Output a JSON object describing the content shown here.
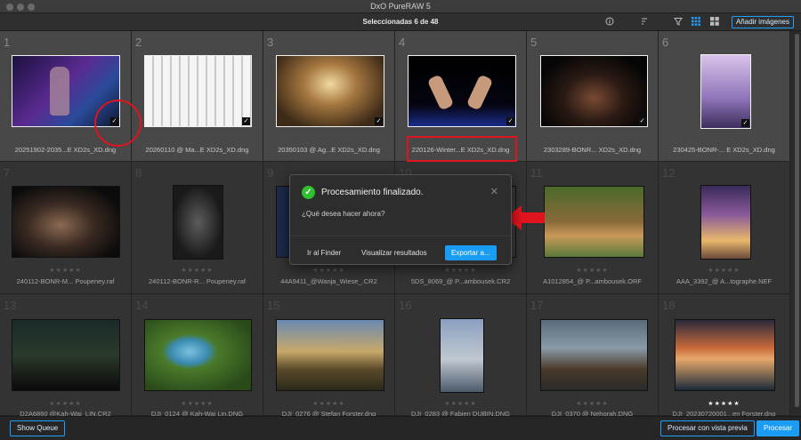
{
  "window": {
    "title": "DxO PureRAW 5"
  },
  "toolbar": {
    "selection_text": "Seleccionadas 6 de 48",
    "add_images_label": "Añadir imágenes",
    "icons": [
      "info-icon",
      "sort-icon",
      "filter-icon",
      "grid-view-icon",
      "compare-view-icon"
    ]
  },
  "colors": {
    "accent": "#1ea0ff",
    "annotation": "#e0141e",
    "success": "#2fbf2f"
  },
  "images": [
    {
      "num": "1",
      "name": "20251902-2035...E XD2s_XD.dng",
      "selected": true,
      "stars": null,
      "rating": 0
    },
    {
      "num": "2",
      "name": "20260110 @ Ma...E XD2s_XD.dng",
      "selected": true,
      "stars": null,
      "rating": 0
    },
    {
      "num": "3",
      "name": "20350103 @ Ag...E XD2s_XD.dng",
      "selected": true,
      "stars": null,
      "rating": 0
    },
    {
      "num": "4",
      "name": "220126-Winter...E XD2s_XD.dng",
      "selected": true,
      "stars": null,
      "rating": 0
    },
    {
      "num": "5",
      "name": "2303289-BONR... XD2s_XD.dng",
      "selected": true,
      "stars": null,
      "rating": 0
    },
    {
      "num": "6",
      "name": "230425-BONR-... E XD2s_XD.dng",
      "selected": true,
      "stars": null,
      "rating": 0
    },
    {
      "num": "7",
      "name": "240112-BONR-M... Poupeney.raf",
      "selected": false,
      "stars": "★★★★★",
      "rating": 0
    },
    {
      "num": "8",
      "name": "240112-BONR-R... Poupeney.raf",
      "selected": false,
      "stars": "★★★★★",
      "rating": 0
    },
    {
      "num": "9",
      "name": "44A9411_@Wanja_Wiese_.CR2",
      "selected": false,
      "stars": "★★★★★",
      "rating": 0
    },
    {
      "num": "10",
      "name": "5DS_8069_@ P...ambousek.CR2",
      "selected": false,
      "stars": "★★★★★",
      "rating": 0
    },
    {
      "num": "11",
      "name": "A1012854_@ P...ambousek.ORF",
      "selected": false,
      "stars": "★★★★★",
      "rating": 0
    },
    {
      "num": "12",
      "name": "AAA_3392_@ A...tographe.NEF",
      "selected": false,
      "stars": "★★★★★",
      "rating": 0
    },
    {
      "num": "13",
      "name": "D2A6860 @Kah-Wai_LIN.CR2",
      "selected": false,
      "stars": "★★★★★",
      "rating": 0
    },
    {
      "num": "14",
      "name": "DJI_0124 @ Kah-Wai Lin.DNG",
      "selected": false,
      "stars": "★★★★★",
      "rating": 0
    },
    {
      "num": "15",
      "name": "DJI_0276 @ Stefan Forster.dng",
      "selected": false,
      "stars": "★★★★★",
      "rating": 0
    },
    {
      "num": "16",
      "name": "DJI_0283 @ Fabien DUBIN.DNG",
      "selected": false,
      "stars": "★★★★★",
      "rating": 0
    },
    {
      "num": "17",
      "name": "DJI_0370 @ Nehorah.DNG",
      "selected": false,
      "stars": "★★★★★",
      "rating": 0
    },
    {
      "num": "18",
      "name": "DJI_20230720001...en Forster.dng",
      "selected": false,
      "stars": "★★★★★",
      "rating": 5
    }
  ],
  "dialog": {
    "title": "Procesamiento finalizado.",
    "question": "¿Qué desea hacer ahora?",
    "finder_label": "Ir al Finder",
    "view_results_label": "Visualizar resultados",
    "export_label": "Exportar a..."
  },
  "bottom": {
    "show_queue_label": "Show Queue",
    "process_preview_label": "Procesar con vista previa",
    "process_label": "Procesar"
  }
}
